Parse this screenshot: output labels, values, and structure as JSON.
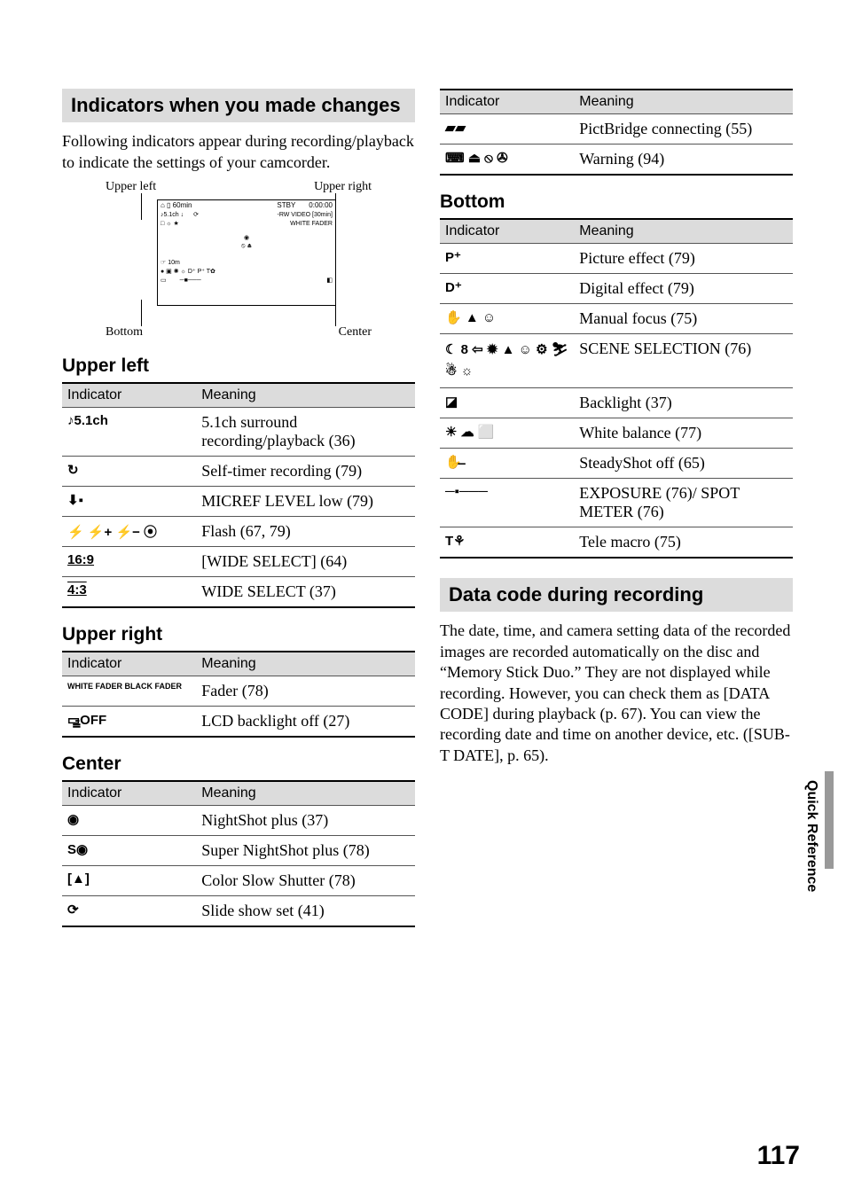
{
  "sections": {
    "changes_title": "Indicators when you made changes",
    "changes_intro": "Following indicators appear during recording/playback to indicate the settings of your camcorder.",
    "datacode_title": "Data code during recording",
    "datacode_body": "The date, time, and camera setting data of the recorded images are recorded automatically on the disc and “Memory Stick Duo.” They are not displayed while recording. However, you can check them as [DATA CODE] during playback (p. 67). You can view the recording date and time on another device, etc. ([SUB-T DATE], p. 65)."
  },
  "diagram": {
    "ul": "Upper left",
    "ur": "Upper right",
    "bottom": "Bottom",
    "center": "Center",
    "lcd_lines": {
      "top_left": "⌂  ▯ 60min",
      "stby": "STBY",
      "time": "0:00:00",
      "rw": "-RW VIDEO [30min]",
      "ch": "♪5.1ch ↓",
      "misc1": "□ ☼ ★",
      "misc2": "WHITE FADER",
      "bot": "□"
    }
  },
  "table_headers": {
    "indicator": "Indicator",
    "meaning": "Meaning"
  },
  "tables": {
    "upper_left": {
      "title": "Upper left",
      "rows": [
        {
          "icon": "♪5.1ch",
          "meaning": "5.1ch surround recording/playback (36)"
        },
        {
          "icon": "↻",
          "meaning": "Self-timer recording (79)"
        },
        {
          "icon": "⬇▪",
          "meaning": "MICREF LEVEL low (79)"
        },
        {
          "icon": "⚡  ⚡+ ⚡−  ⦿",
          "meaning": "Flash (67, 79)"
        },
        {
          "icon": "16:9",
          "meaning": "[WIDE SELECT] (64)"
        },
        {
          "icon": "4:3",
          "meaning": "WIDE SELECT (37)"
        }
      ]
    },
    "upper_right": {
      "title": "Upper right",
      "rows": [
        {
          "icon": "WHITE FADER  BLACK FADER",
          "meaning": "Fader (78)"
        },
        {
          "icon": "▭̵̳OFF",
          "meaning": "LCD backlight off (27)"
        }
      ]
    },
    "center": {
      "title": "Center",
      "rows": [
        {
          "icon": "◉",
          "meaning": "NightShot plus (37)"
        },
        {
          "icon": "S◉",
          "meaning": "Super NightShot plus (78)"
        },
        {
          "icon": "[▲]",
          "meaning": "Color Slow Shutter (78)"
        },
        {
          "icon": "⟳",
          "meaning": "Slide show set (41)"
        }
      ]
    },
    "center_cont": {
      "rows": [
        {
          "icon": "▰▰",
          "meaning": "PictBridge connecting (55)"
        },
        {
          "icon": "⌨ ⏏ ⦸  ✇",
          "meaning": "Warning (94)"
        }
      ]
    },
    "bottom": {
      "title": "Bottom",
      "rows": [
        {
          "icon": "P⁺",
          "meaning": "Picture effect (79)"
        },
        {
          "icon": "D⁺",
          "meaning": "Digital effect (79)"
        },
        {
          "icon": "✋ ▲ ☺",
          "meaning": "Manual focus (75)"
        },
        {
          "icon": "☾ 8 ⇦  ✹ ▲ ☺ ⚙  ⛷ ☃ ☼",
          "meaning": "SCENE SELECTION (76)"
        },
        {
          "icon": "◪",
          "meaning": "Backlight (37)"
        },
        {
          "icon": "☀ ☁ ⬜",
          "meaning": "White balance (77)"
        },
        {
          "icon": "✋̶",
          "meaning": "SteadyShot off (65)"
        },
        {
          "icon": "─▪───",
          "meaning": "EXPOSURE (76)/ SPOT METER (76)"
        },
        {
          "icon": "T⚘",
          "meaning": "Tele macro (75)"
        }
      ]
    }
  },
  "side_tab": "Quick Reference",
  "page_number": "117"
}
